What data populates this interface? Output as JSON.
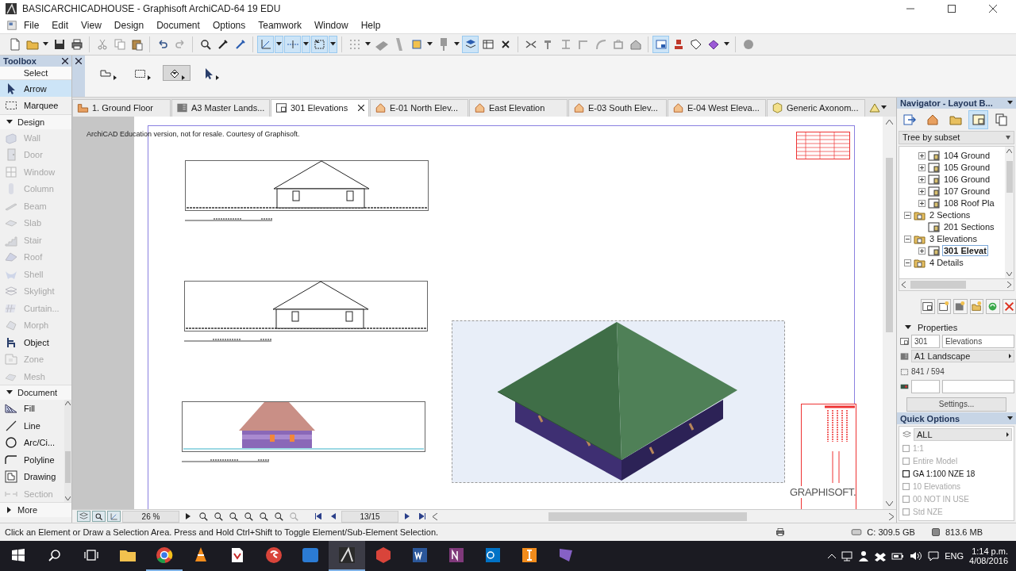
{
  "window": {
    "title": "BASICARCHICADHOUSE - Graphisoft ArchiCAD-64 19 EDU"
  },
  "menu": [
    "File",
    "Edit",
    "View",
    "Design",
    "Document",
    "Options",
    "Teamwork",
    "Window",
    "Help"
  ],
  "toolbar": [
    {
      "kind": "new",
      "selected": false
    },
    {
      "kind": "open",
      "selected": false
    },
    {
      "kind": "menu",
      "selected": false
    },
    {
      "kind": "save",
      "selected": false
    },
    {
      "kind": "print",
      "selected": false
    },
    {
      "kind": "sep"
    },
    {
      "kind": "cut",
      "selected": false
    },
    {
      "kind": "copy",
      "selected": false
    },
    {
      "kind": "paste",
      "selected": false
    },
    {
      "kind": "sep"
    },
    {
      "kind": "undo",
      "selected": false
    },
    {
      "kind": "redo",
      "selected": false
    },
    {
      "kind": "sep"
    },
    {
      "kind": "find",
      "selected": false
    },
    {
      "kind": "pick",
      "selected": false
    },
    {
      "kind": "inject",
      "selected": false
    },
    {
      "kind": "sep"
    },
    {
      "kind": "angle",
      "selected": true
    },
    {
      "kind": "menu",
      "selected": true
    },
    {
      "kind": "snap",
      "selected": true
    },
    {
      "kind": "menu",
      "selected": true
    },
    {
      "kind": "cursor",
      "selected": true
    },
    {
      "kind": "menu",
      "selected": true
    },
    {
      "kind": "sep"
    },
    {
      "kind": "grid",
      "selected": false
    },
    {
      "kind": "menu",
      "selected": false
    },
    {
      "kind": "wedge",
      "selected": false
    },
    {
      "kind": "pen",
      "selected": false
    },
    {
      "kind": "cube",
      "selected": false
    },
    {
      "kind": "menu",
      "selected": false
    },
    {
      "kind": "pin",
      "selected": false
    },
    {
      "kind": "menu",
      "selected": false
    },
    {
      "kind": "stack",
      "selected": true
    },
    {
      "kind": "table",
      "selected": false
    },
    {
      "kind": "cross",
      "selected": false
    },
    {
      "kind": "sep"
    },
    {
      "kind": "trim",
      "selected": false
    },
    {
      "kind": "hammer",
      "selected": false
    },
    {
      "kind": "level",
      "selected": false
    },
    {
      "kind": "corner",
      "selected": false
    },
    {
      "kind": "curve",
      "selected": false
    },
    {
      "kind": "box",
      "selected": false
    },
    {
      "kind": "house",
      "selected": false
    },
    {
      "kind": "sep"
    },
    {
      "kind": "layout",
      "selected": true
    },
    {
      "kind": "stamp",
      "selected": false
    },
    {
      "kind": "tag",
      "selected": false
    },
    {
      "kind": "gem",
      "selected": false
    },
    {
      "kind": "menu",
      "selected": false
    },
    {
      "kind": "sep"
    },
    {
      "kind": "dot",
      "selected": false
    }
  ],
  "toolbox": {
    "title": "Toolbox",
    "sections": [
      {
        "label": "Select",
        "kind": "header",
        "items": [
          {
            "label": "Arrow",
            "kind": "arrow",
            "selected": true,
            "disabled": false
          },
          {
            "label": "Marquee",
            "kind": "marquee",
            "selected": false,
            "disabled": false
          }
        ]
      },
      {
        "label": "Design",
        "kind": "group",
        "expanded": true,
        "items": [
          {
            "label": "Wall",
            "kind": "wall",
            "selected": false,
            "disabled": true
          },
          {
            "label": "Door",
            "kind": "door",
            "selected": false,
            "disabled": true
          },
          {
            "label": "Window",
            "kind": "window",
            "selected": false,
            "disabled": true
          },
          {
            "label": "Column",
            "kind": "column",
            "selected": false,
            "disabled": true
          },
          {
            "label": "Beam",
            "kind": "beam",
            "selected": false,
            "disabled": true
          },
          {
            "label": "Slab",
            "kind": "slab",
            "selected": false,
            "disabled": true
          },
          {
            "label": "Stair",
            "kind": "stair",
            "selected": false,
            "disabled": true
          },
          {
            "label": "Roof",
            "kind": "roof",
            "selected": false,
            "disabled": true
          },
          {
            "label": "Shell",
            "kind": "shell",
            "selected": false,
            "disabled": true
          },
          {
            "label": "Skylight",
            "kind": "skylight",
            "selected": false,
            "disabled": true
          },
          {
            "label": "Curtain...",
            "kind": "curtain",
            "selected": false,
            "disabled": true
          },
          {
            "label": "Morph",
            "kind": "morph",
            "selected": false,
            "disabled": true
          },
          {
            "label": "Object",
            "kind": "object",
            "selected": false,
            "disabled": false
          },
          {
            "label": "Zone",
            "kind": "zone",
            "selected": false,
            "disabled": true
          },
          {
            "label": "Mesh",
            "kind": "mesh",
            "selected": false,
            "disabled": true
          }
        ]
      },
      {
        "label": "Document",
        "kind": "scroll",
        "expanded": true,
        "items": [
          {
            "label": "Fill",
            "kind": "fill",
            "selected": false,
            "disabled": false
          },
          {
            "label": "Line",
            "kind": "line",
            "selected": false,
            "disabled": false
          },
          {
            "label": "Arc/Ci...",
            "kind": "arc",
            "selected": false,
            "disabled": false
          },
          {
            "label": "Polyline",
            "kind": "polyline",
            "selected": false,
            "disabled": false
          },
          {
            "label": "Drawing",
            "kind": "drawing",
            "selected": false,
            "disabled": false
          },
          {
            "label": "Section",
            "kind": "section",
            "selected": false,
            "disabled": true
          }
        ]
      },
      {
        "label": "More",
        "kind": "group",
        "expanded": false
      }
    ]
  },
  "info_box": {
    "tools": [
      {
        "kind": "polygon",
        "selected": false
      },
      {
        "kind": "rectangle",
        "selected": false
      },
      {
        "kind": "fill",
        "selected": true
      },
      {
        "kind": "pointer",
        "selected": false
      }
    ]
  },
  "tabs": [
    {
      "label": "1. Ground Floor",
      "kind": "story",
      "selected": false
    },
    {
      "label": "A3 Master Lands...",
      "kind": "master",
      "selected": false
    },
    {
      "label": "301 Elevations",
      "kind": "layout",
      "selected": true
    },
    {
      "label": "E-01 North Elev...",
      "kind": "elevation",
      "selected": false
    },
    {
      "label": "East Elevation",
      "kind": "elevation",
      "selected": false
    },
    {
      "label": "E-03 South Elev...",
      "kind": "elevation",
      "selected": false
    },
    {
      "label": "E-04 West Eleva...",
      "kind": "elevation",
      "selected": false
    },
    {
      "label": "Generic Axonom...",
      "kind": "axonometry",
      "selected": false
    }
  ],
  "canvas": {
    "notice": "ArchiCAD Education version, not for resale. Courtesy of Graphisoft.",
    "logo": "GRAPHISOFT."
  },
  "view_bar": {
    "zoom": "26 %",
    "page": "13/15"
  },
  "navigator": {
    "title": "Navigator - Layout B...",
    "view_buttons": [
      {
        "kind": "organizer",
        "selected": false
      },
      {
        "kind": "project",
        "selected": false
      },
      {
        "kind": "views",
        "selected": false
      },
      {
        "kind": "layouts",
        "selected": true
      },
      {
        "kind": "publisher",
        "selected": false
      }
    ],
    "mode": "Tree by subset",
    "tree": [
      {
        "label": "104 Ground",
        "kind": "layout",
        "expanded": false,
        "selected": false
      },
      {
        "label": "105 Ground",
        "kind": "layout",
        "expanded": false,
        "selected": false
      },
      {
        "label": "106 Ground",
        "kind": "layout",
        "expanded": false,
        "selected": false
      },
      {
        "label": "107 Ground",
        "kind": "layout",
        "expanded": false,
        "selected": false
      },
      {
        "label": "108 Roof Pla",
        "kind": "layout",
        "expanded": false,
        "selected": false
      },
      {
        "label": "2 Sections",
        "kind": "folder",
        "expanded": true,
        "selected": false,
        "children": [
          {
            "label": "201 Sections",
            "kind": "layout",
            "selected": false
          }
        ]
      },
      {
        "label": "3 Elevations",
        "kind": "folder",
        "expanded": true,
        "selected": false,
        "children": [
          {
            "label": "301 Elevat",
            "kind": "layout",
            "expanded": false,
            "selected": true
          }
        ]
      },
      {
        "label": "4 Details",
        "kind": "folder",
        "expanded": true,
        "selected": false
      }
    ],
    "properties": {
      "title": "Properties",
      "number": "301",
      "name": "Elevations",
      "master": "A1 Landscape",
      "size": "841 / 594",
      "button": "Settings..."
    }
  },
  "quick_options": {
    "title": "Quick Options",
    "filter": "ALL",
    "items": [
      {
        "label": "1:1",
        "disabled": true
      },
      {
        "label": "Entire Model",
        "disabled": true
      },
      {
        "label": "GA 1:100 NZE 18",
        "disabled": false
      },
      {
        "label": "10 Elevations",
        "disabled": true
      },
      {
        "label": "00 NOT IN USE",
        "disabled": true
      },
      {
        "label": "Std NZE",
        "disabled": true
      }
    ]
  },
  "status_bar": {
    "message": "Click an Element or Draw a Selection Area. Press and Hold Ctrl+Shift to Toggle Element/Sub-Element Selection.",
    "disk": "C: 309.5 GB",
    "memory": "813.6 MB"
  },
  "taskbar": {
    "apps": [
      {
        "kind": "explorer",
        "running": false,
        "selected": false
      },
      {
        "kind": "chrome",
        "running": true,
        "selected": false
      },
      {
        "kind": "vlc",
        "running": false,
        "selected": false
      },
      {
        "kind": "pdf",
        "running": false,
        "selected": false
      },
      {
        "kind": "swirl",
        "running": false,
        "selected": false
      },
      {
        "kind": "up",
        "running": false,
        "selected": false
      },
      {
        "kind": "archicad",
        "running": true,
        "selected": true
      },
      {
        "kind": "sketch",
        "running": false,
        "selected": false
      },
      {
        "kind": "word",
        "running": false,
        "selected": false
      },
      {
        "kind": "note",
        "running": false,
        "selected": false
      },
      {
        "kind": "mail",
        "running": false,
        "selected": false
      },
      {
        "kind": "orange",
        "running": false,
        "selected": false
      },
      {
        "kind": "ribbon",
        "running": false,
        "selected": false
      }
    ],
    "language": "ENG",
    "time": "1:14 p.m.",
    "date": "4/08/2016"
  }
}
